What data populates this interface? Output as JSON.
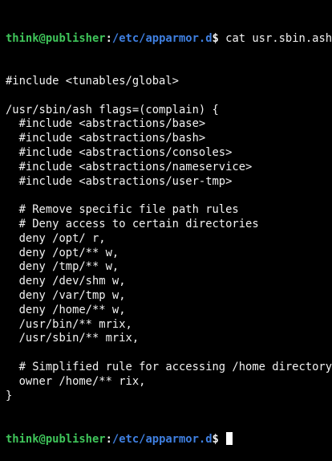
{
  "colors": {
    "background": "#000000",
    "text": "#f2f2f2",
    "prompt_user_host": "#3fc55a",
    "prompt_path": "#3f7fe0",
    "cursor": "#ffffff"
  },
  "prompt": {
    "user_host": "think@publisher",
    "separator": ":",
    "path": "/etc/apparmor.d",
    "symbol": "$",
    "command": " cat usr.sbin.ash"
  },
  "output_lines": [
    "#include <tunables/global>",
    "",
    "/usr/sbin/ash flags=(complain) {",
    "  #include <abstractions/base>",
    "  #include <abstractions/bash>",
    "  #include <abstractions/consoles>",
    "  #include <abstractions/nameservice>",
    "  #include <abstractions/user-tmp>",
    "",
    "  # Remove specific file path rules",
    "  # Deny access to certain directories",
    "  deny /opt/ r,",
    "  deny /opt/** w,",
    "  deny /tmp/** w,",
    "  deny /dev/shm w,",
    "  deny /var/tmp w,",
    "  deny /home/** w,",
    "  /usr/bin/** mrix,",
    "  /usr/sbin/** mrix,",
    "",
    "  # Simplified rule for accessing /home directory",
    "  owner /home/** rix,",
    "}"
  ],
  "final_prompt": {
    "user_host": "think@publisher",
    "separator": ":",
    "path": "/etc/apparmor.d",
    "symbol": "$",
    "command": " "
  }
}
